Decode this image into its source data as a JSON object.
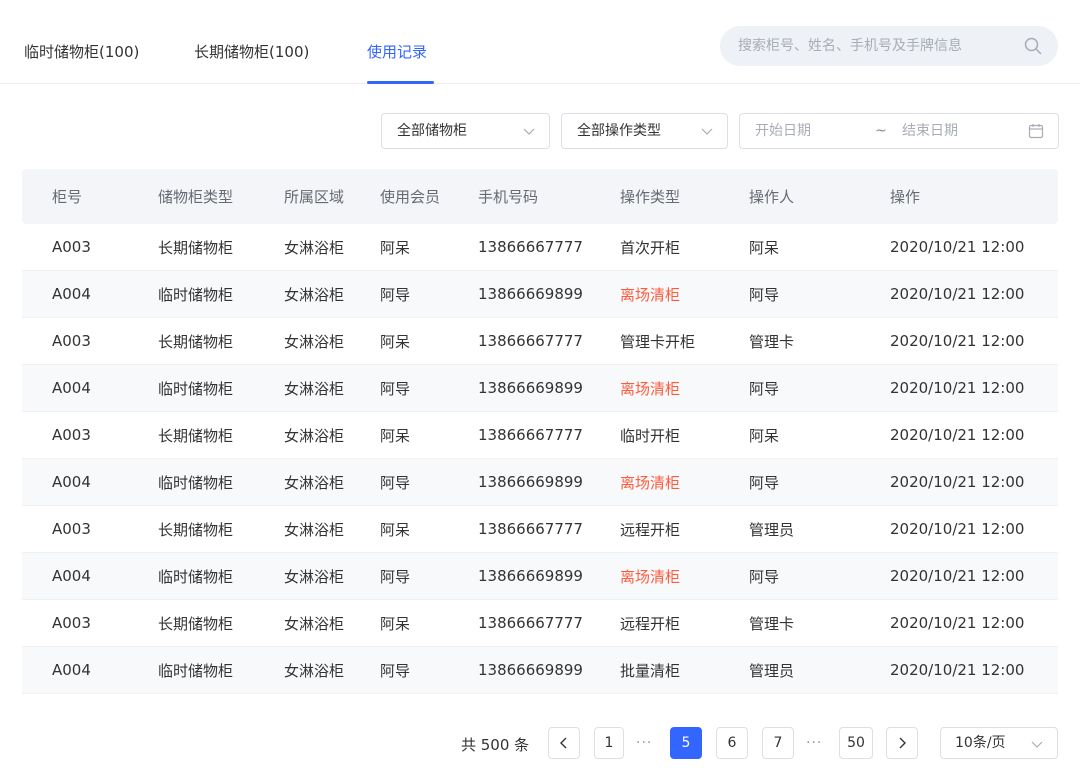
{
  "tabs": [
    {
      "label": "临时储物柜(100)"
    },
    {
      "label": "长期储物柜(100)"
    },
    {
      "label": "使用记录"
    }
  ],
  "search": {
    "placeholder": "搜索柜号、姓名、手机号及手牌信息"
  },
  "filters": {
    "cabinet_select": "全部储物柜",
    "operation_select": "全部操作类型",
    "start_date_placeholder": "开始日期",
    "date_separator": "~",
    "end_date_placeholder": "结束日期"
  },
  "table": {
    "headers": [
      "柜号",
      "储物柜类型",
      "所属区域",
      "使用会员",
      "手机号码",
      "操作类型",
      "操作人",
      "操作"
    ],
    "rows": [
      [
        "A003",
        "长期储物柜",
        "女淋浴柜",
        "阿呆",
        "13866667777",
        "首次开柜",
        "阿呆",
        "2020/10/21 12:00"
      ],
      [
        "A004",
        "临时储物柜",
        "女淋浴柜",
        "阿导",
        "13866669899",
        "离场清柜",
        "阿导",
        "2020/10/21 12:00"
      ],
      [
        "A003",
        "长期储物柜",
        "女淋浴柜",
        "阿呆",
        "13866667777",
        "管理卡开柜",
        "管理卡",
        "2020/10/21 12:00"
      ],
      [
        "A004",
        "临时储物柜",
        "女淋浴柜",
        "阿导",
        "13866669899",
        "离场清柜",
        "阿导",
        "2020/10/21 12:00"
      ],
      [
        "A003",
        "长期储物柜",
        "女淋浴柜",
        "阿呆",
        "13866667777",
        "临时开柜",
        "阿呆",
        "2020/10/21 12:00"
      ],
      [
        "A004",
        "临时储物柜",
        "女淋浴柜",
        "阿导",
        "13866669899",
        "离场清柜",
        "阿导",
        "2020/10/21 12:00"
      ],
      [
        "A003",
        "长期储物柜",
        "女淋浴柜",
        "阿呆",
        "13866667777",
        "远程开柜",
        "管理员",
        "2020/10/21 12:00"
      ],
      [
        "A004",
        "临时储物柜",
        "女淋浴柜",
        "阿导",
        "13866669899",
        "离场清柜",
        "阿导",
        "2020/10/21 12:00"
      ],
      [
        "A003",
        "长期储物柜",
        "女淋浴柜",
        "阿呆",
        "13866667777",
        "远程开柜",
        "管理卡",
        "2020/10/21 12:00"
      ],
      [
        "A004",
        "临时储物柜",
        "女淋浴柜",
        "阿导",
        "13866669899",
        "批量清柜",
        "管理员",
        "2020/10/21 12:00"
      ]
    ]
  },
  "pagination": {
    "total_text": "共 500 条",
    "pages": [
      "1",
      "5",
      "6",
      "7",
      "50"
    ],
    "ellipsis": "···",
    "page_size": "10条/页"
  },
  "colors": {
    "accent": "#3366ff",
    "warning_text": "#ff5a3c"
  },
  "icons": {
    "search": "search-icon",
    "chevron": "chevron-down-icon",
    "calendar": "calendar-icon"
  }
}
